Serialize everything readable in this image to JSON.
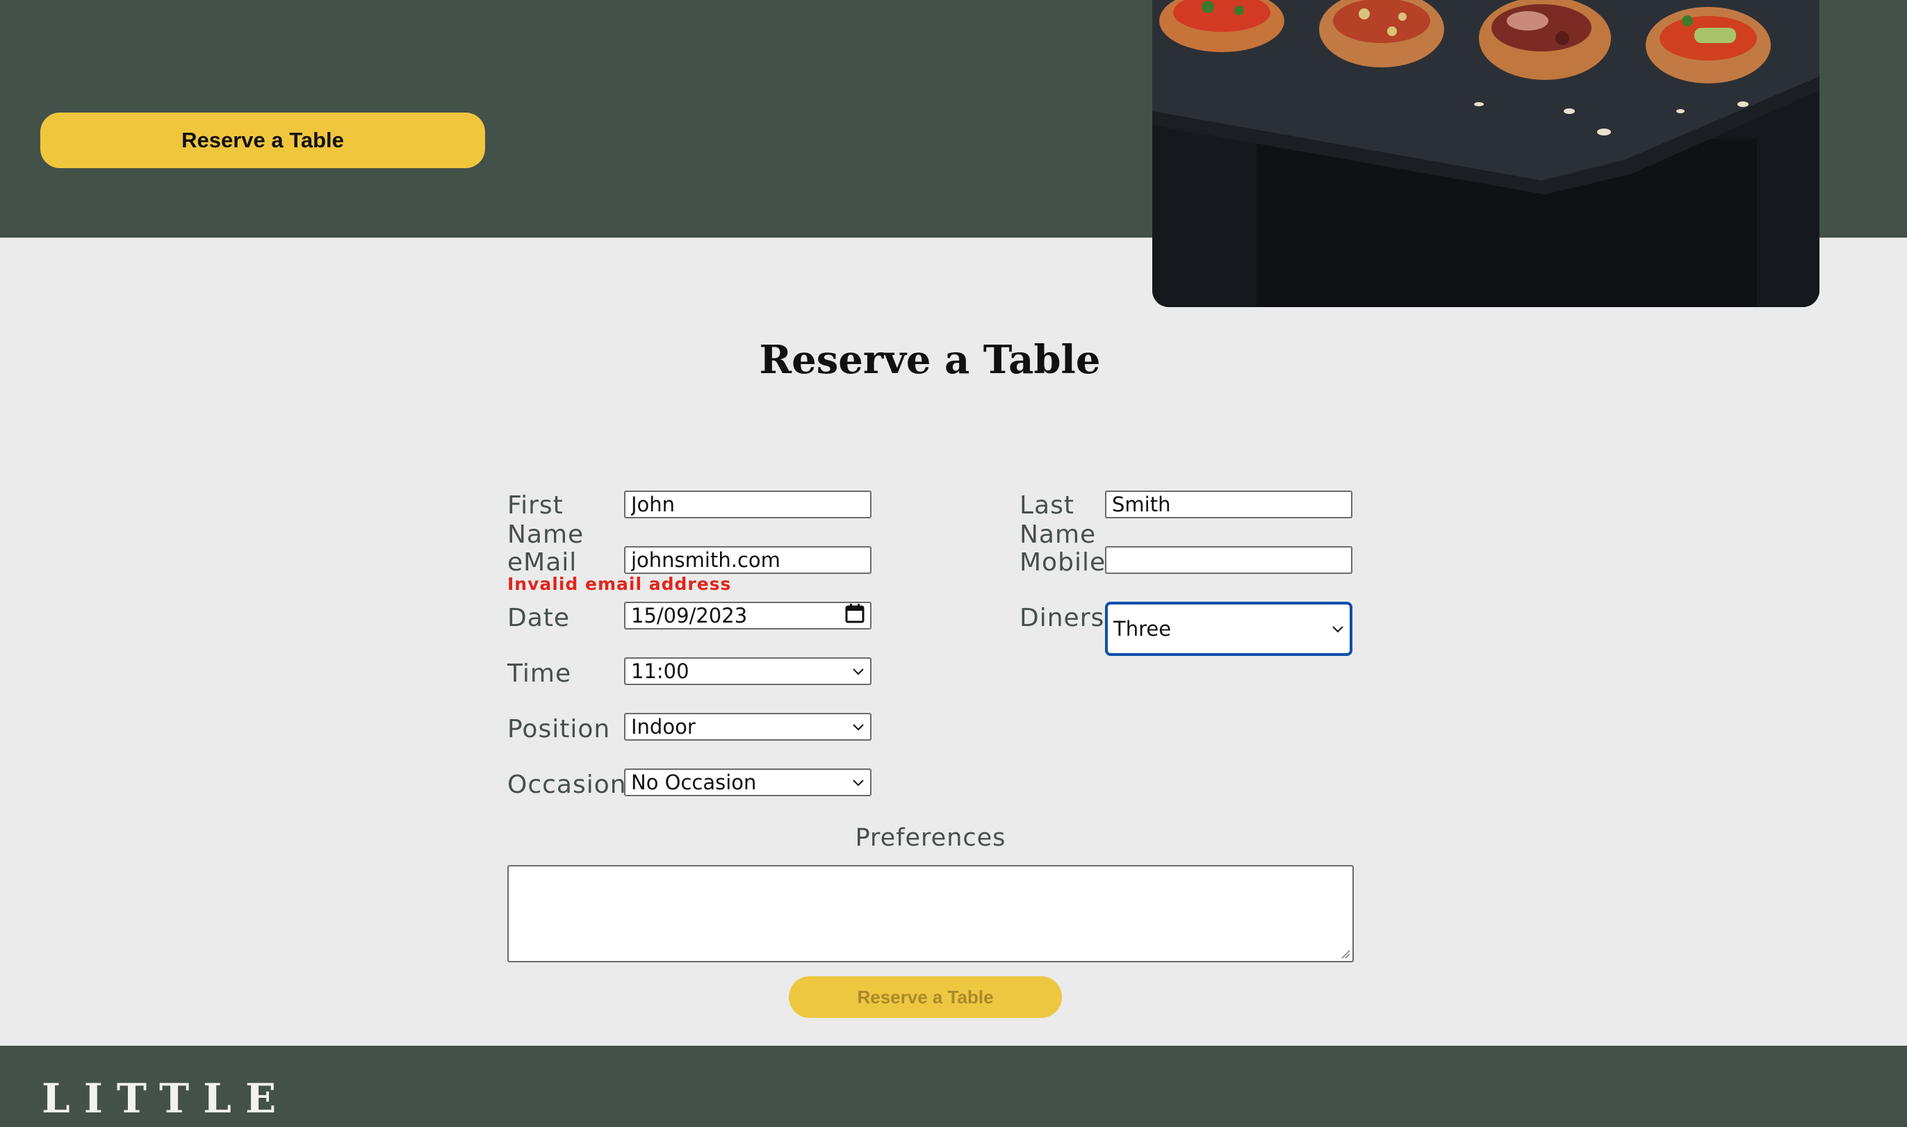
{
  "hero": {
    "reserve_button_label": "Reserve a Table"
  },
  "form": {
    "title": "Reserve a Table",
    "first_name": {
      "label_line1": "First",
      "label_line2": "Name",
      "value": "John"
    },
    "last_name": {
      "label_line1": "Last",
      "label_line2": "Name",
      "value": "Smith"
    },
    "email": {
      "label": "eMail",
      "value": "johnsmith.com",
      "error": "Invalid email address"
    },
    "mobile": {
      "label": "Mobile",
      "value": ""
    },
    "date": {
      "label": "Date",
      "value": "15/09/2023"
    },
    "diners": {
      "label": "Diners",
      "value": "Three"
    },
    "time": {
      "label": "Time",
      "value": "11:00"
    },
    "position": {
      "label": "Position",
      "value": "Indoor"
    },
    "occasion": {
      "label": "Occasion",
      "value": "No Occasion"
    },
    "preferences": {
      "label": "Preferences",
      "value": ""
    },
    "submit_label": "Reserve a Table"
  },
  "footer": {
    "logo_text": "LITTLE"
  },
  "colors": {
    "brand_green": "#445149",
    "brand_yellow": "#f0c63d",
    "error_red": "#e0261c",
    "focus_blue": "#0b4fa9",
    "page_background": "#ebebeb"
  },
  "icons": {
    "select_arrow": "chevron-down-icon",
    "date_picker": "calendar-icon",
    "textarea_resize": "resize-handle-icon"
  }
}
